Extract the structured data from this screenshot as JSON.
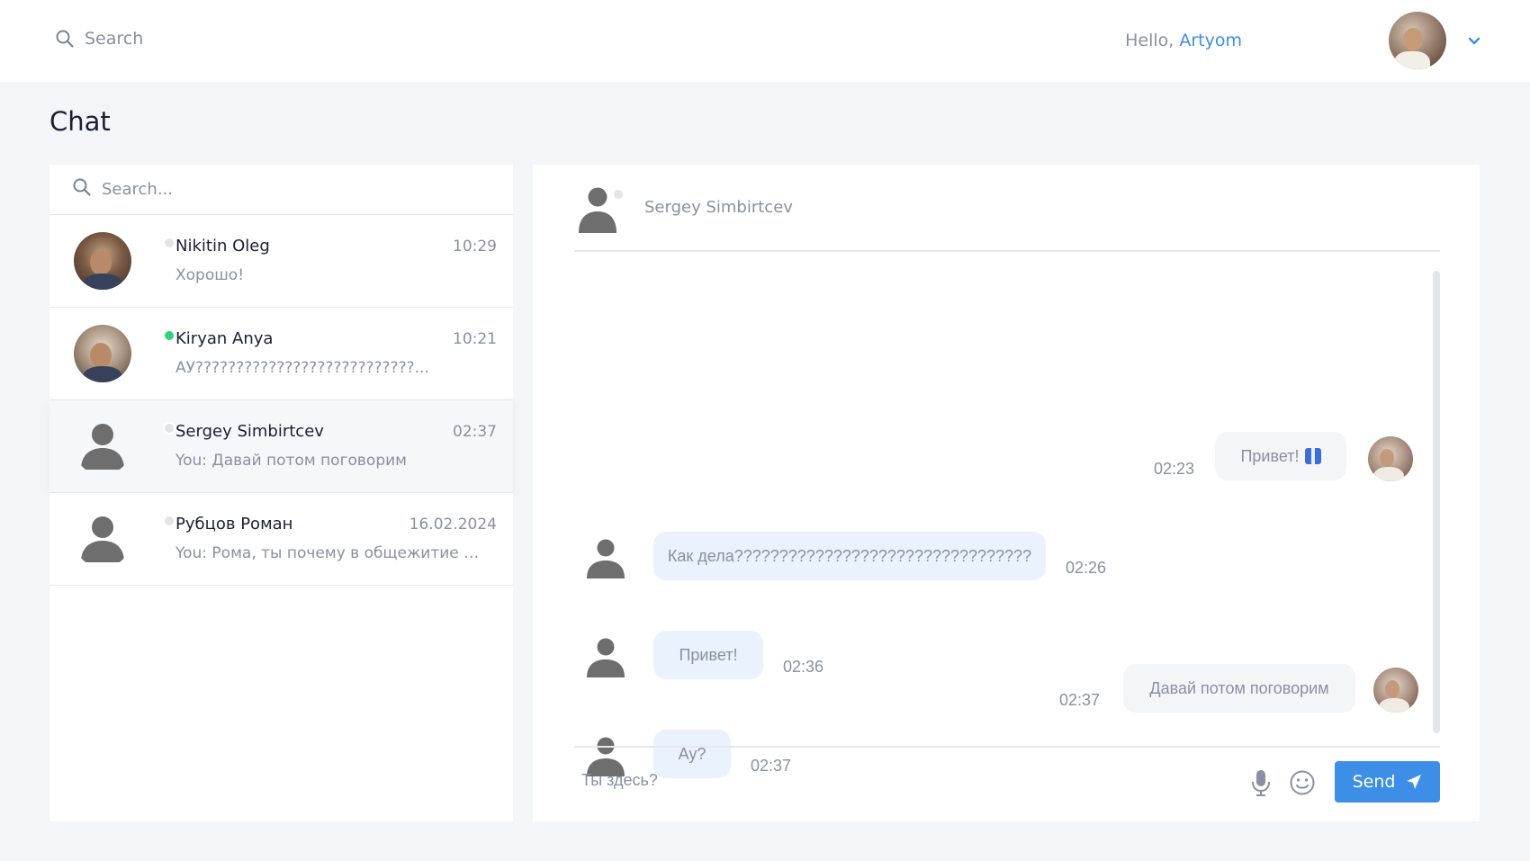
{
  "topbar": {
    "search_placeholder": "Search",
    "greeting_prefix": "Hello, ",
    "user_name": "Artyom"
  },
  "page": {
    "title": "Chat"
  },
  "chat_list": {
    "search_placeholder": "Search...",
    "items": [
      {
        "name": "Nikitin Oleg",
        "time": "10:29",
        "preview": "Хорошо!",
        "status": "offline",
        "avatar": "photo"
      },
      {
        "name": "Kiryan Anya",
        "time": "10:21",
        "preview": "АУ???????????????????????????...",
        "status": "online",
        "avatar": "photo"
      },
      {
        "name": "Sergey Simbirtcev",
        "time": "02:37",
        "preview": "You: Давай потом поговорим",
        "status": "offline",
        "avatar": "silhouette",
        "active": true
      },
      {
        "name": "Рубцов Роман",
        "time": "16.02.2024",
        "preview": "You: Рома, ты почему в общежитие 3...",
        "status": "offline",
        "avatar": "silhouette"
      }
    ]
  },
  "conversation": {
    "contact_name": "Sergey Simbirtcev",
    "messages": [
      {
        "direction": "out",
        "text": "Привет!",
        "time": "02:23",
        "emoji": "gift-icon"
      },
      {
        "direction": "in",
        "text": "Как дела?????????????????????????????????",
        "time": "02:26"
      },
      {
        "direction": "in",
        "text": "Привет!",
        "time": "02:36"
      },
      {
        "direction": "in",
        "text": "Ау?",
        "time": "02:37"
      },
      {
        "direction": "out",
        "text": "Давай потом поговорим",
        "time": "02:37"
      }
    ]
  },
  "composer": {
    "placeholder": "Ты здесь?",
    "send_label": "Send"
  },
  "colors": {
    "accent": "#3d8ee6",
    "online": "#2fd27a",
    "background": "#f4f5f9",
    "incoming_bubble": "#eaf2fd",
    "outgoing_bubble": "#f4f5f7"
  }
}
